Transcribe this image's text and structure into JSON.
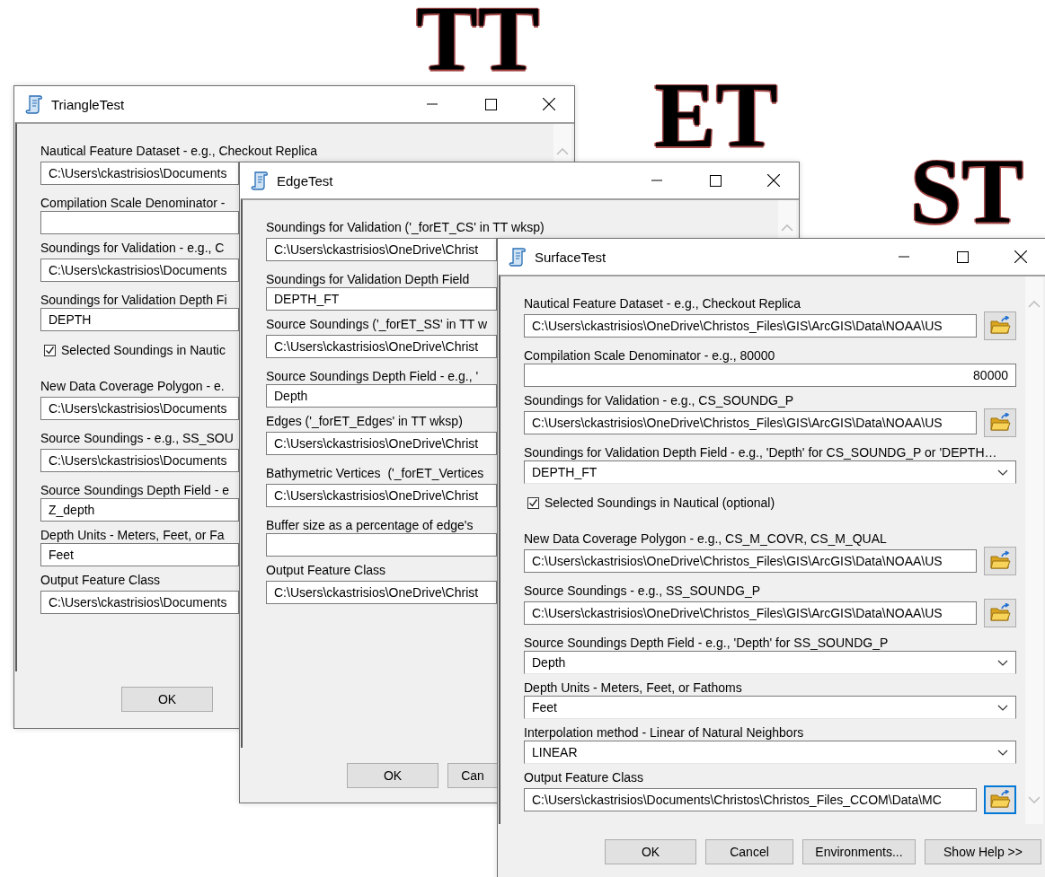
{
  "tags": [
    "TT",
    "ET",
    "ST"
  ],
  "windows": [
    {
      "title": "TriangleTest",
      "rows": [
        {
          "kind": "path",
          "label": "Nautical Feature Dataset - e.g., Checkout Replica",
          "value": "C:\\Users\\ckastrisios\\Documents"
        },
        {
          "kind": "text",
          "label": "Compilation Scale Denominator -"
        },
        {
          "kind": "path",
          "label": "Soundings for Validation - e.g., C",
          "value": "C:\\Users\\ckastrisios\\Documents"
        },
        {
          "kind": "text",
          "label": "Soundings for Validation Depth Fi",
          "value": "DEPTH"
        },
        {
          "kind": "check",
          "label": "Selected Soundings in Nautic",
          "checked": true
        },
        {
          "kind": "path",
          "label": "New Data Coverage Polygon - e.",
          "value": "C:\\Users\\ckastrisios\\Documents"
        },
        {
          "kind": "path",
          "label": "Source Soundings - e.g., SS_SOU",
          "value": "C:\\Users\\ckastrisios\\Documents"
        },
        {
          "kind": "text",
          "label": "Source Soundings Depth Field - e",
          "value": "Z_depth"
        },
        {
          "kind": "text",
          "label": "Depth Units - Meters, Feet, or Fa",
          "value": "Feet"
        },
        {
          "kind": "path",
          "label": "Output Feature Class",
          "value": "C:\\Users\\ckastrisios\\Documents"
        }
      ],
      "buttons": [
        "OK"
      ]
    },
    {
      "title": "EdgeTest",
      "rows": [
        {
          "kind": "path",
          "label": "Soundings for Validation ('_forET_CS' in TT wksp)",
          "value": "C:\\Users\\ckastrisios\\OneDrive\\Christ"
        },
        {
          "kind": "text",
          "label": "Soundings for Validation Depth Field",
          "value": "DEPTH_FT"
        },
        {
          "kind": "path",
          "label": "Source Soundings ('_forET_SS' in TT w",
          "value": "C:\\Users\\ckastrisios\\OneDrive\\Christ"
        },
        {
          "kind": "text",
          "label": "Source Soundings Depth Field - e.g., '",
          "value": "Depth"
        },
        {
          "kind": "path",
          "label": "Edges ('_forET_Edges' in TT wksp)",
          "value": "C:\\Users\\ckastrisios\\OneDrive\\Christ"
        },
        {
          "kind": "path",
          "label": "Bathymetric Vertices  ('_forET_Vertices",
          "value": "C:\\Users\\ckastrisios\\OneDrive\\Christ"
        },
        {
          "kind": "text",
          "label": "Buffer size as a percentage of edge's"
        },
        {
          "kind": "path",
          "label": "Output Feature Class",
          "value": "C:\\Users\\ckastrisios\\OneDrive\\Christ"
        }
      ],
      "buttons": [
        "OK",
        "Can"
      ]
    },
    {
      "title": "SurfaceTest",
      "rows": [
        {
          "kind": "path",
          "label": "Nautical Feature Dataset - e.g., Checkout Replica",
          "value": "C:\\Users\\ckastrisios\\OneDrive\\Christos_Files\\GIS\\ArcGIS\\Data\\NOAA\\US",
          "browse": true,
          "focused": false
        },
        {
          "kind": "number",
          "label": "Compilation Scale Denominator - e.g., 80000",
          "value": "80000"
        },
        {
          "kind": "path",
          "label": "Soundings for Validation - e.g., CS_SOUNDG_P",
          "value": "C:\\Users\\ckastrisios\\OneDrive\\Christos_Files\\GIS\\ArcGIS\\Data\\NOAA\\US",
          "browse": true,
          "focused": false
        },
        {
          "kind": "combo",
          "label": "Soundings for Validation Depth Field - e.g., 'Depth' for CS_SOUNDG_P or 'DEPTH…",
          "value": "DEPTH_FT"
        },
        {
          "kind": "check",
          "label": "Selected Soundings in Nautical (optional)",
          "checked": true
        },
        {
          "kind": "path",
          "label": "New Data Coverage Polygon - e.g., CS_M_COVR, CS_M_QUAL",
          "value": "C:\\Users\\ckastrisios\\OneDrive\\Christos_Files\\GIS\\ArcGIS\\Data\\NOAA\\US",
          "browse": true,
          "focused": false
        },
        {
          "kind": "path",
          "label": "Source Soundings - e.g., SS_SOUNDG_P",
          "value": "C:\\Users\\ckastrisios\\OneDrive\\Christos_Files\\GIS\\ArcGIS\\Data\\NOAA\\US",
          "browse": true,
          "focused": false
        },
        {
          "kind": "combo",
          "label": "Source Soundings Depth Field - e.g., 'Depth' for SS_SOUNDG_P",
          "value": "Depth"
        },
        {
          "kind": "combo",
          "label": "Depth Units - Meters, Feet, or Fathoms",
          "value": "Feet"
        },
        {
          "kind": "combo",
          "label": "Interpolation method - Linear of Natural Neighbors",
          "value": "LINEAR"
        },
        {
          "kind": "path",
          "label": "Output Feature Class",
          "value": "C:\\Users\\ckastrisios\\Documents\\Christos\\Christos_Files_CCOM\\Data\\MC",
          "browse": true,
          "focused": true
        }
      ],
      "buttons": [
        "OK",
        "Cancel",
        "Environments...",
        "Show Help >>"
      ]
    }
  ]
}
